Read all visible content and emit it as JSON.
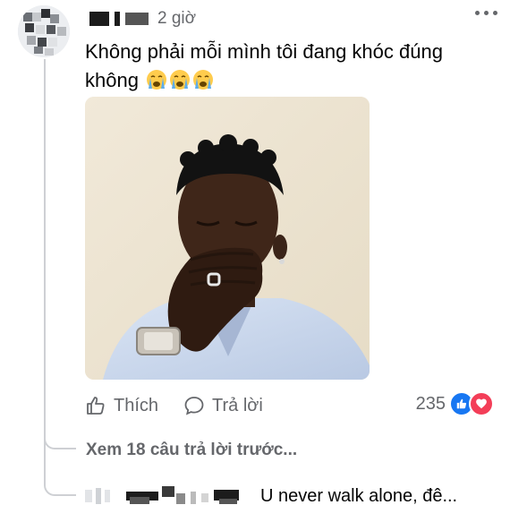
{
  "comment": {
    "time": "2 giờ",
    "text": "Không phải mỗi mình tôi đang khóc đúng không",
    "emojis": [
      "crying-face",
      "crying-face",
      "crying-face"
    ]
  },
  "actions": {
    "like_label": "Thích",
    "reply_label": "Trả lời",
    "reaction_count": "235",
    "reactions": [
      "like",
      "love"
    ]
  },
  "replies": {
    "view_previous": "Xem 18 câu trả lời trước...",
    "last_reply_text": "U never walk alone, đê..."
  },
  "colors": {
    "text": "#050505",
    "secondary": "#65676b",
    "like_blue": "#1877f2",
    "love_red": "#f33e58"
  }
}
